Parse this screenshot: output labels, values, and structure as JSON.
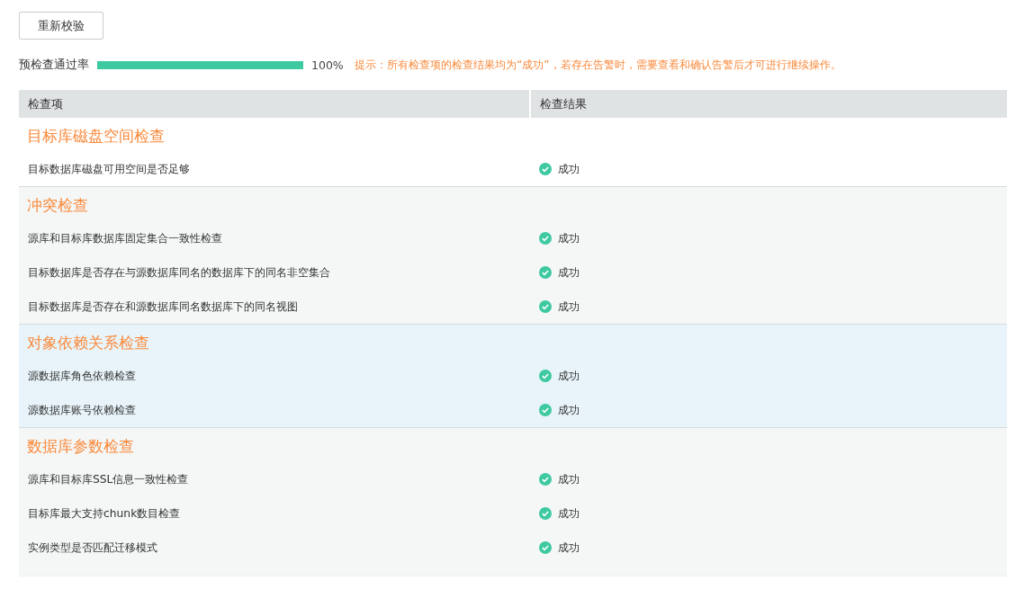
{
  "recheck_button": "重新校验",
  "pass_rate": {
    "label": "预检查通过率",
    "level": 1,
    "reading": "100%"
  },
  "hint": "提示：所有检查项的检查结果均为“成功”，若存在告警时，需要查看和确认告警后才可进行继续操作。",
  "table": {
    "columns": [
      "检查项",
      "检查结果"
    ],
    "groups": [
      {
        "title": "目标库磁盘空间检查",
        "highlighted": false,
        "rows": [
          {
            "item": "目标数据库磁盘可用空间是否足够",
            "kind": "success",
            "result": "成功"
          }
        ]
      },
      {
        "title": "冲突检查",
        "highlighted": false,
        "rows": [
          {
            "item": "源库和目标库数据库固定集合一致性检查",
            "kind": "success",
            "result": "成功"
          },
          {
            "item": "目标数据库是否存在与源数据库同名的数据库下的同名非空集合",
            "kind": "success",
            "result": "成功"
          },
          {
            "item": "目标数据库是否存在和源数据库同名数据库下的同名视图",
            "kind": "success",
            "result": "成功"
          }
        ]
      },
      {
        "title": "对象依赖关系检查",
        "highlighted": true,
        "rows": [
          {
            "item": "源数据库角色依赖检查",
            "kind": "success",
            "result": "成功"
          },
          {
            "item": "源数据库账号依赖检查",
            "kind": "success",
            "result": "成功"
          }
        ]
      },
      {
        "title": "数据库参数检查",
        "highlighted": false,
        "rows": [
          {
            "item": "源库和目标库SSL信息一致性检查",
            "kind": "success",
            "result": "成功"
          },
          {
            "item": "目标库最大支持chunk数目检查",
            "kind": "success",
            "result": "成功"
          },
          {
            "item": "实例类型是否匹配迁移模式",
            "kind": "success",
            "result": "成功"
          }
        ]
      }
    ]
  }
}
